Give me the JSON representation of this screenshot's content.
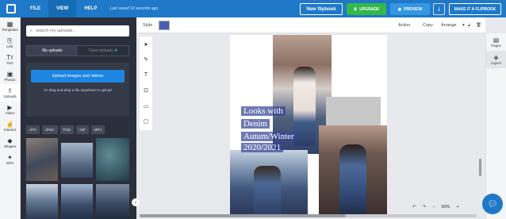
{
  "topbar": {
    "menu": [
      "FILE",
      "VIEW",
      "HELP"
    ],
    "saved_text": "Last saved 10 seconds ago",
    "new_flipbook": "New flipbook",
    "upgrade": "UPGRADE",
    "preview": "PREVIEW",
    "make_flipbook": "MAKE IT A FLIPBOOK"
  },
  "left_rail": [
    "Templates",
    "Link",
    "Text",
    "Photos",
    "Uploads",
    "Video",
    "Interact",
    "Shapes",
    "GIFs"
  ],
  "uploads": {
    "search_placeholder": "search my uploads...",
    "tab_my": "My uploads",
    "tab_team": "Team uploads",
    "upload_button": "Upload images and videos",
    "drag_text": "Or drag and drop a file anywhere to upload",
    "filters": [
      "JPG",
      "JPEG",
      "PNG",
      "GIF",
      "MP4"
    ]
  },
  "toolbar": {
    "style_label": "Style",
    "action": "Action",
    "copy": "Copy",
    "arrange": "Arrange"
  },
  "page": {
    "title_lines": [
      "Looks with",
      "Denim",
      "Autum/Winter",
      "2020/2021"
    ]
  },
  "right_rail": [
    "Pages",
    "Layers"
  ],
  "zoom": {
    "value": "60%",
    "minus": "−",
    "plus": "+"
  },
  "colors": {
    "brand": "#1f78c8",
    "upgrade": "#33b94a",
    "panel": "#2a2f3b",
    "swatch": "#4a5fb3"
  }
}
